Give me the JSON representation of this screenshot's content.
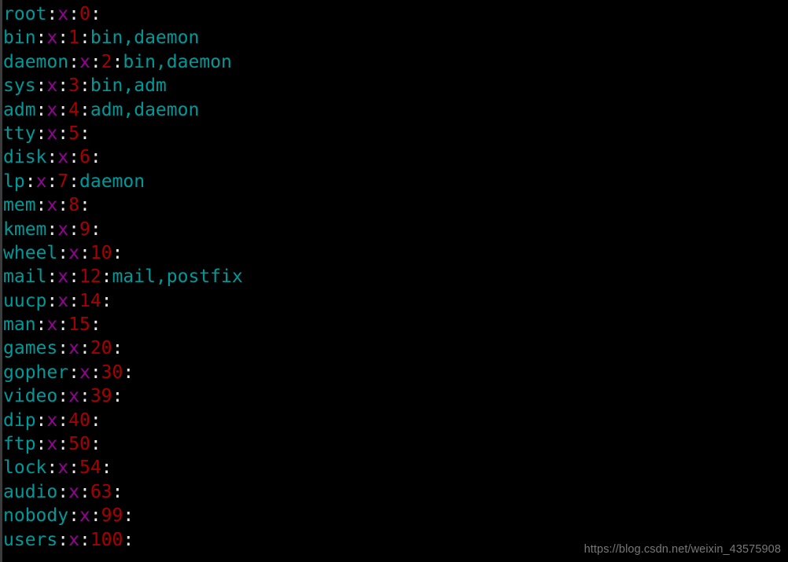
{
  "terminal": {
    "background_color": "#000000",
    "colors": {
      "group_name": "#009999",
      "separator": "#e8e8e8",
      "password_placeholder": "#990099",
      "gid": "#a80000",
      "members": "#009999",
      "watermark": "#787878",
      "left_edge_strip": "#3b3b3b"
    },
    "separator": ":",
    "lines": [
      {
        "name": "root",
        "passwd": "x",
        "gid": "0",
        "members": ""
      },
      {
        "name": "bin",
        "passwd": "x",
        "gid": "1",
        "members": "bin,daemon"
      },
      {
        "name": "daemon",
        "passwd": "x",
        "gid": "2",
        "members": "bin,daemon"
      },
      {
        "name": "sys",
        "passwd": "x",
        "gid": "3",
        "members": "bin,adm"
      },
      {
        "name": "adm",
        "passwd": "x",
        "gid": "4",
        "members": "adm,daemon"
      },
      {
        "name": "tty",
        "passwd": "x",
        "gid": "5",
        "members": ""
      },
      {
        "name": "disk",
        "passwd": "x",
        "gid": "6",
        "members": ""
      },
      {
        "name": "lp",
        "passwd": "x",
        "gid": "7",
        "members": "daemon"
      },
      {
        "name": "mem",
        "passwd": "x",
        "gid": "8",
        "members": ""
      },
      {
        "name": "kmem",
        "passwd": "x",
        "gid": "9",
        "members": ""
      },
      {
        "name": "wheel",
        "passwd": "x",
        "gid": "10",
        "members": ""
      },
      {
        "name": "mail",
        "passwd": "x",
        "gid": "12",
        "members": "mail,postfix"
      },
      {
        "name": "uucp",
        "passwd": "x",
        "gid": "14",
        "members": ""
      },
      {
        "name": "man",
        "passwd": "x",
        "gid": "15",
        "members": ""
      },
      {
        "name": "games",
        "passwd": "x",
        "gid": "20",
        "members": ""
      },
      {
        "name": "gopher",
        "passwd": "x",
        "gid": "30",
        "members": ""
      },
      {
        "name": "video",
        "passwd": "x",
        "gid": "39",
        "members": ""
      },
      {
        "name": "dip",
        "passwd": "x",
        "gid": "40",
        "members": ""
      },
      {
        "name": "ftp",
        "passwd": "x",
        "gid": "50",
        "members": ""
      },
      {
        "name": "lock",
        "passwd": "x",
        "gid": "54",
        "members": ""
      },
      {
        "name": "audio",
        "passwd": "x",
        "gid": "63",
        "members": ""
      },
      {
        "name": "nobody",
        "passwd": "x",
        "gid": "99",
        "members": ""
      },
      {
        "name": "users",
        "passwd": "x",
        "gid": "100",
        "members": ""
      }
    ]
  },
  "watermark": {
    "text": "https://blog.csdn.net/weixin_43575908"
  }
}
